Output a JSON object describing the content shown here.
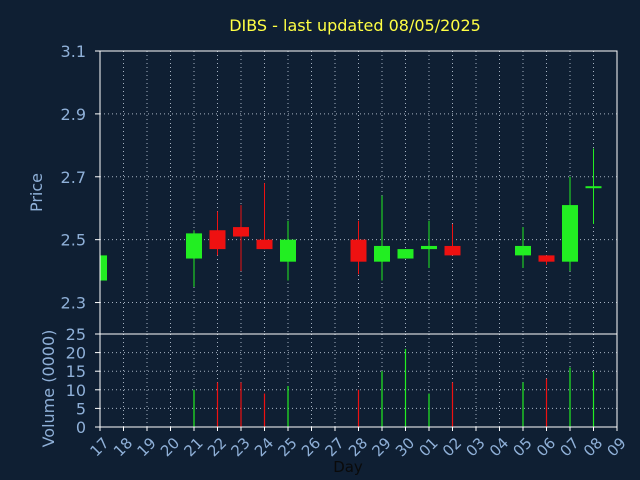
{
  "chart_data": [
    {
      "type": "candlestick",
      "title": "DIBS - last updated 08/05/2025",
      "ylabel": "Price",
      "ylim": [
        2.2,
        3.1
      ],
      "yticks": [
        "3.1",
        "2.9",
        "2.7",
        "2.5",
        "2.3"
      ],
      "ytick_values": [
        3.1,
        2.9,
        2.7,
        2.5,
        2.3
      ],
      "grid": true,
      "categories": [
        "17",
        "18",
        "19",
        "20",
        "21",
        "22",
        "23",
        "24",
        "25",
        "26",
        "27",
        "28",
        "29",
        "30",
        "01",
        "02",
        "03",
        "04",
        "05",
        "06",
        "07",
        "08",
        "09"
      ],
      "candles": [
        {
          "day": "17",
          "open": 2.37,
          "high": 2.45,
          "low": 2.37,
          "close": 2.45
        },
        {
          "day": "21",
          "open": 2.44,
          "high": 2.53,
          "low": 2.35,
          "close": 2.52
        },
        {
          "day": "22",
          "open": 2.53,
          "high": 2.59,
          "low": 2.45,
          "close": 2.47
        },
        {
          "day": "23",
          "open": 2.54,
          "high": 2.61,
          "low": 2.4,
          "close": 2.51
        },
        {
          "day": "24",
          "open": 2.5,
          "high": 2.68,
          "low": 2.47,
          "close": 2.47
        },
        {
          "day": "25",
          "open": 2.43,
          "high": 2.56,
          "low": 2.37,
          "close": 2.5
        },
        {
          "day": "28",
          "open": 2.5,
          "high": 2.56,
          "low": 2.39,
          "close": 2.43
        },
        {
          "day": "29",
          "open": 2.43,
          "high": 2.64,
          "low": 2.37,
          "close": 2.48
        },
        {
          "day": "30",
          "open": 2.44,
          "high": 2.47,
          "low": 2.44,
          "close": 2.47
        },
        {
          "day": "01",
          "open": 2.47,
          "high": 2.56,
          "low": 2.41,
          "close": 2.48
        },
        {
          "day": "02",
          "open": 2.48,
          "high": 2.55,
          "low": 2.45,
          "close": 2.45
        },
        {
          "day": "05",
          "open": 2.45,
          "high": 2.54,
          "low": 2.41,
          "close": 2.48
        },
        {
          "day": "06",
          "open": 2.45,
          "high": 2.45,
          "low": 2.42,
          "close": 2.43
        },
        {
          "day": "07",
          "open": 2.43,
          "high": 2.7,
          "low": 2.4,
          "close": 2.61
        },
        {
          "day": "08",
          "open": 2.67,
          "high": 2.79,
          "low": 2.55,
          "close": 2.67
        }
      ]
    },
    {
      "type": "bar",
      "ylabel": "Volume (0000)",
      "xlabel": "Day",
      "ylim": [
        0,
        25
      ],
      "yticks": [
        "25",
        "20",
        "15",
        "10",
        "5",
        "0"
      ],
      "ytick_values": [
        25,
        20,
        15,
        10,
        5,
        0
      ],
      "grid": true,
      "categories": [
        "17",
        "18",
        "19",
        "20",
        "21",
        "22",
        "23",
        "24",
        "25",
        "26",
        "27",
        "28",
        "29",
        "30",
        "01",
        "02",
        "03",
        "04",
        "05",
        "06",
        "07",
        "08",
        "09"
      ],
      "bars": [
        {
          "day": "21",
          "value": 10,
          "direction": "up"
        },
        {
          "day": "22",
          "value": 12,
          "direction": "down"
        },
        {
          "day": "23",
          "value": 12,
          "direction": "down"
        },
        {
          "day": "24",
          "value": 9,
          "direction": "down"
        },
        {
          "day": "25",
          "value": 11,
          "direction": "up"
        },
        {
          "day": "28",
          "value": 10,
          "direction": "down"
        },
        {
          "day": "29",
          "value": 15,
          "direction": "up"
        },
        {
          "day": "30",
          "value": 21,
          "direction": "up"
        },
        {
          "day": "01",
          "value": 9,
          "direction": "up"
        },
        {
          "day": "02",
          "value": 12,
          "direction": "down"
        },
        {
          "day": "05",
          "value": 12,
          "direction": "up"
        },
        {
          "day": "06",
          "value": 13,
          "direction": "down"
        },
        {
          "day": "07",
          "value": 16,
          "direction": "up"
        },
        {
          "day": "08",
          "value": 15,
          "direction": "up"
        }
      ]
    }
  ],
  "colors": {
    "background": "#0f1f33",
    "up": "#22ee22",
    "down": "#ee1111",
    "title": "#ffff44",
    "axis_text": "#8fb0d8",
    "grid": "#a6b2c2",
    "frame": "#ffffff"
  }
}
